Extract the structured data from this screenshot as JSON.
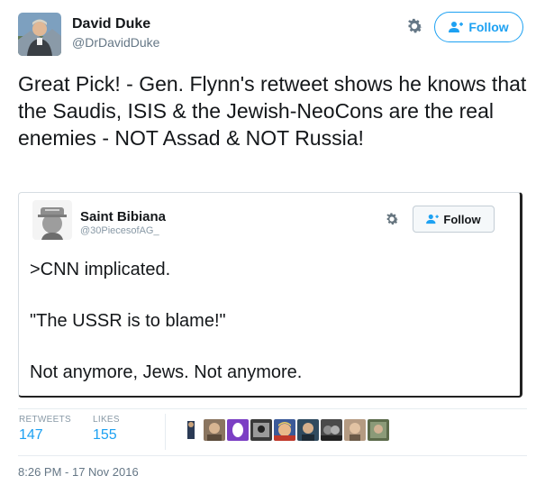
{
  "author": {
    "name": "David Duke",
    "handle": "@DrDavidDuke",
    "avatar_icon": "user-avatar-photo"
  },
  "actions": {
    "follow_label": "Follow",
    "settings_icon": "gear-icon",
    "follow_icon": "add-user-icon"
  },
  "tweet": {
    "text": "Great Pick! - Gen. Flynn's retweet shows he knows that the Saudis, ISIS & the Jewish-NeoCons are the real enemies - NOT Assad & NOT Russia!"
  },
  "embedded_tweet": {
    "name": "Saint Bibiana",
    "handle": "@30PiecesofAG_",
    "follow_label": "Follow",
    "lines": [
      ">CNN implicated.",
      "\"The USSR is to blame!\"",
      "Not anymore, Jews. Not anymore."
    ]
  },
  "stats": {
    "retweets_label": "RETWEETS",
    "retweets": "147",
    "likes_label": "LIKES",
    "likes": "155"
  },
  "likers": [
    {
      "icon": "liker-avatar-1",
      "color": "#2b3a55"
    },
    {
      "icon": "liker-avatar-2",
      "color": "#8a7560"
    },
    {
      "icon": "liker-avatar-3",
      "color": "#7b3fc4"
    },
    {
      "icon": "liker-avatar-4",
      "color": "#3a3a3a"
    },
    {
      "icon": "liker-avatar-5",
      "color": "#c9a27a"
    },
    {
      "icon": "liker-avatar-6",
      "color": "#2f4a5f"
    },
    {
      "icon": "liker-avatar-7",
      "color": "#4a4a4a"
    },
    {
      "icon": "liker-avatar-8",
      "color": "#b59b82"
    },
    {
      "icon": "liker-avatar-9",
      "color": "#5b6a4a"
    }
  ],
  "timestamp": "8:26 PM - 17 Nov 2016",
  "colors": {
    "accent": "#1da1f2",
    "text": "#14171a",
    "muted": "#657786"
  }
}
